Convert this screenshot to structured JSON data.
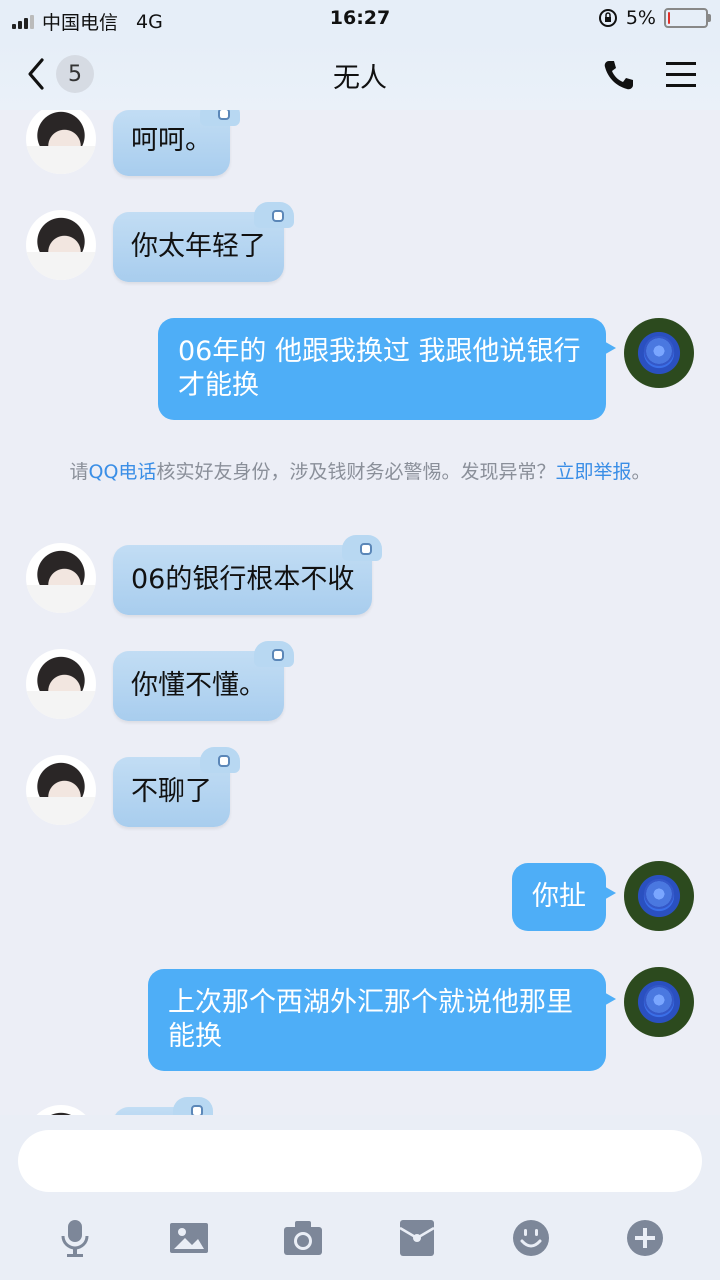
{
  "statusbar": {
    "carrier": "中国电信",
    "network": "4G",
    "time": "16:27",
    "battery": "5%",
    "battery_level": 0.05
  },
  "navbar": {
    "back_count": "5",
    "title": "无人"
  },
  "messages": [
    {
      "side": "in",
      "text": "呵呵。"
    },
    {
      "side": "in",
      "text": "你太年轻了"
    },
    {
      "side": "out",
      "text": "06年的 他跟我换过 我跟他说银行才能换"
    },
    {
      "side": "notice",
      "text_before": "请",
      "link1": "QQ电话",
      "text_middle": "核实好友身份，涉及钱财务必警惕。发现异常？",
      "link2": "立即举报",
      "text_after": "。"
    },
    {
      "side": "in",
      "text": "06的银行根本不收"
    },
    {
      "side": "in",
      "text": "你懂不懂。"
    },
    {
      "side": "in",
      "text": "不聊了"
    },
    {
      "side": "out",
      "text": "你扯"
    },
    {
      "side": "out",
      "text": "上次那个西湖外汇那个就说他那里能换"
    }
  ],
  "input": {
    "value": "",
    "placeholder": ""
  },
  "toolbar": {
    "icons": [
      "microphone-icon",
      "image-icon",
      "camera-icon",
      "red-packet-icon",
      "emoji-icon",
      "plus-icon"
    ]
  },
  "colors": {
    "outgoing_bubble": "#4eaef7",
    "incoming_bubble": "#b8d8f2",
    "link": "#3a8ee6"
  }
}
